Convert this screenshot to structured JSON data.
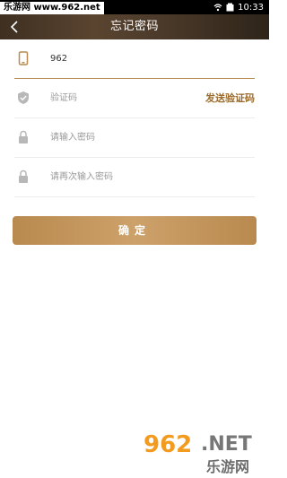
{
  "status_bar": {
    "watermark_text": "乐游网 www.962.net",
    "time": "10:33"
  },
  "header": {
    "title": "忘记密码"
  },
  "form": {
    "phone_value": "962",
    "code_placeholder": "验证码",
    "send_code_label": "发送验证码",
    "password_placeholder": "请输入密码",
    "confirm_password_placeholder": "请再次输入密码"
  },
  "confirm_button_label": "确定",
  "watermark": {
    "primary": "962",
    "secondary": ".NET",
    "cn": "乐游网"
  },
  "colors": {
    "accent": "#b88a4f",
    "accent_text": "#9a6b2c"
  }
}
